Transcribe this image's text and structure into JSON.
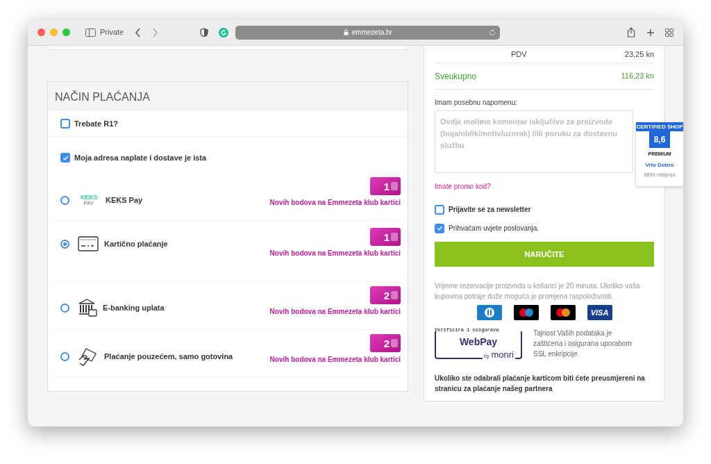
{
  "browser": {
    "private_label": "Private",
    "url": "emmezeta.hr"
  },
  "payment": {
    "title": "NAČIN PLAĆANJA",
    "options": [
      {
        "label": "Trebate R1?",
        "checked": false
      },
      {
        "label": "Moja adresa naplate i dostave je ista",
        "checked": true
      }
    ],
    "methods": [
      {
        "kind": "keks",
        "label": "KEKS Pay",
        "logo_text": "KEKS",
        "logo_sub": "PAY",
        "selected": false,
        "points": "1",
        "points_label": "Novih bodova na Emmezeta klub kartici"
      },
      {
        "kind": "card",
        "label": "Kartično plaćanje",
        "selected": true,
        "points": "1",
        "points_label": "Novih bodova na Emmezeta klub kartici"
      },
      {
        "kind": "bank",
        "label": "E-banking uplata",
        "selected": false,
        "points": "2",
        "points_label": "Novih bodova na Emmezeta klub kartici"
      },
      {
        "kind": "cash",
        "label": "Plaćanje pouzećem, samo gotovina",
        "selected": false,
        "points": "2",
        "points_label": "Novih bodova na Emmezeta klub kartici"
      }
    ]
  },
  "summary": {
    "vat_label": "PDV",
    "vat_value": "23,25 kn",
    "total_label": "Sveukupno",
    "total_value": "116,23 kn",
    "note_label": "Imam posebnu napomenu:",
    "note_placeholder": "Ovdje molimo komentar isključivo za proizvode (boja/oblik/motiv/uzorak) i/ili poruku za dostavnu službu",
    "promo_link": "Imate promo kod?",
    "checks": [
      {
        "label": "Prijavite se za newsletter",
        "checked": false,
        "bold": true
      },
      {
        "label": "Prihvaćam uvjete poslovanja.",
        "checked": true,
        "bold": false
      }
    ],
    "order_button": "NARUČITE",
    "reservation_note": "Vrijeme rezervacije proizvoda u košarici je 20 minuta. Ukoliko vaša kupovina potraje duže moguća je promjena raspoloživosti.",
    "cards": [
      {
        "kind": "diners"
      },
      {
        "kind": "maestro"
      },
      {
        "kind": "mastercard"
      },
      {
        "kind": "visa",
        "text": "VISA"
      }
    ],
    "webpay": {
      "top": "Verificira i osigurava",
      "name": "WebPay",
      "by": "by",
      "brand": "monri"
    },
    "security_note": "Tajnost Vaših podataka je zaštićena i osigurana uporabom SSL enkripcije.",
    "redirect_note": "Ukoliko ste odabrali plaćanje karticom biti ćete preusmjereni na stranicu za plaćanje našeg partnera"
  },
  "badge": {
    "header": "CERTIFIED SHOP",
    "score": "8,6",
    "tier": "PREMIUM",
    "rating": "Vrlo Dobro",
    "reviews": "6809 mišljenja"
  }
}
